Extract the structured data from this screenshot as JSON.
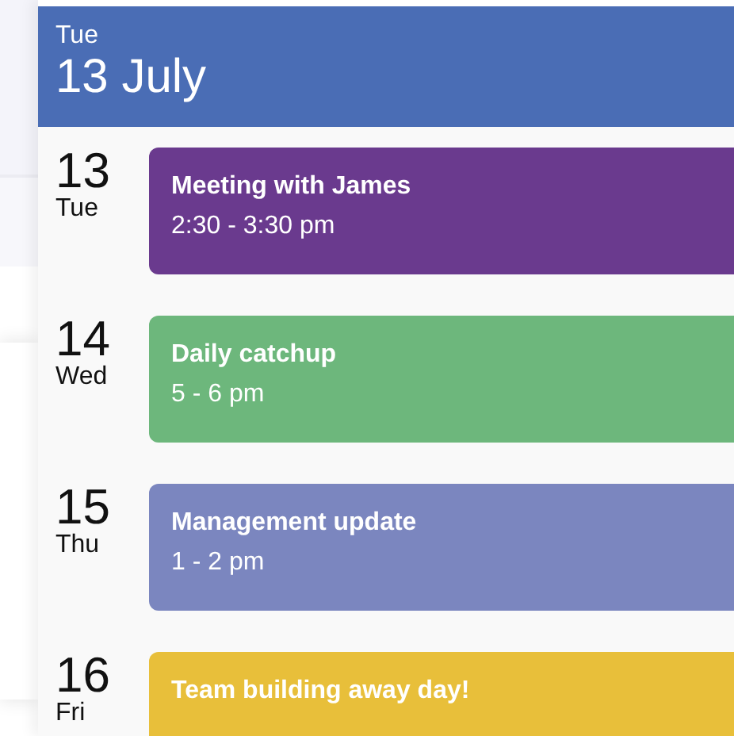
{
  "header": {
    "weekday": "Tue",
    "date": "13 July"
  },
  "days": [
    {
      "number": "13",
      "weekday": "Tue",
      "event": {
        "title": "Meeting with James",
        "time": "2:30 - 3:30 pm",
        "color": "#6a3a8e"
      }
    },
    {
      "number": "14",
      "weekday": "Wed",
      "event": {
        "title": "Daily catchup",
        "time": "5 - 6 pm",
        "color": "#6db77c"
      }
    },
    {
      "number": "15",
      "weekday": "Thu",
      "event": {
        "title": "Management update",
        "time": "1 - 2 pm",
        "color": "#7b86bf"
      }
    },
    {
      "number": "16",
      "weekday": "Fri",
      "event": {
        "title": "Team building away day!",
        "color": "#e8bf3a"
      }
    }
  ]
}
